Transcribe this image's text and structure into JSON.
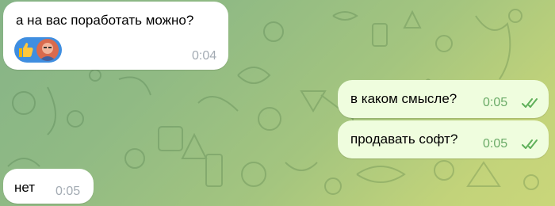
{
  "chat": {
    "messages": [
      {
        "direction": "incoming",
        "text": "а на вас поработать можно?",
        "time": "0:04",
        "reactions": [
          {
            "icon": "thumbs-up-icon",
            "reactor": "user-avatar"
          }
        ]
      },
      {
        "direction": "outgoing",
        "text": "в каком смысле?",
        "time": "0:05",
        "status": "read"
      },
      {
        "direction": "outgoing",
        "text": "продавать софт?",
        "time": "0:05",
        "status": "read"
      },
      {
        "direction": "incoming",
        "text": "нет",
        "time": "0:05"
      }
    ]
  },
  "colors": {
    "incoming_bubble": "#ffffff",
    "outgoing_bubble": "#effdde",
    "outgoing_time": "#6bab68",
    "incoming_time": "#a3abb3",
    "read_check": "#5fb05a",
    "reaction_pill": "#3f8ee0"
  }
}
